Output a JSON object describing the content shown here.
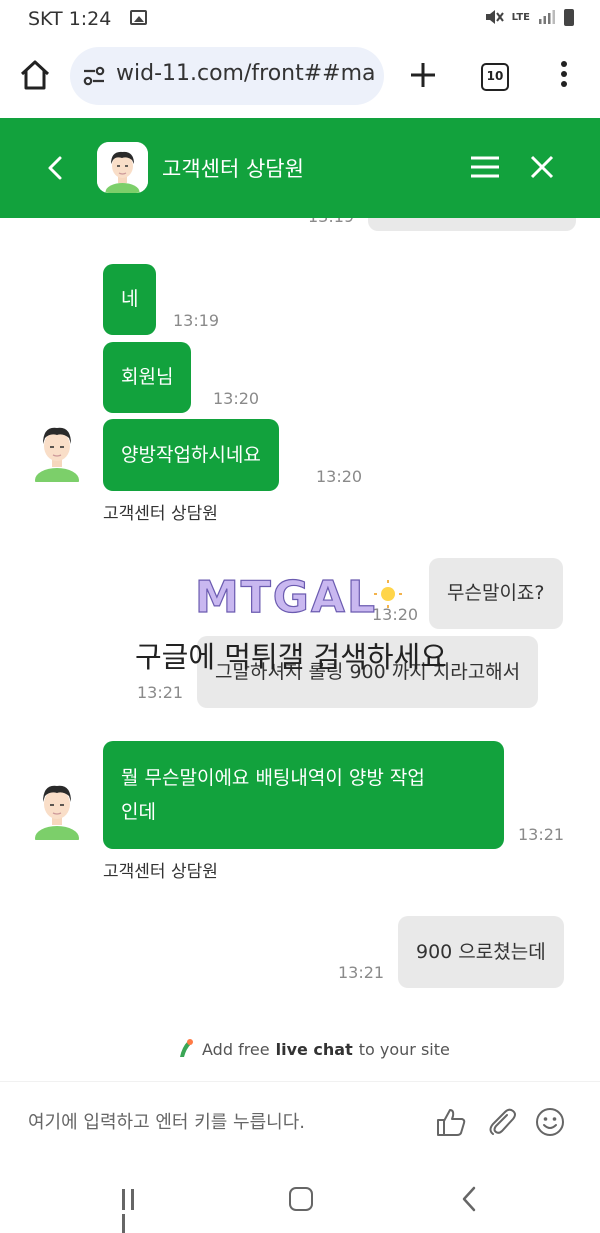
{
  "status_bar": {
    "carrier_time": "SKT 1:24",
    "network": "LTE"
  },
  "browser": {
    "url": "wid-11.com/front##ma",
    "tab_count": "10"
  },
  "header": {
    "title": "고객센터 상담원"
  },
  "messages": {
    "partial_time_top": "13:19",
    "m1": {
      "text": "네",
      "time": "13:19"
    },
    "m2": {
      "text": "회원님",
      "time": "13:20"
    },
    "m3": {
      "text": "양방작업하시네요",
      "time": "13:20"
    },
    "sender1": "고객센터 상담원",
    "u1": {
      "text": "무슨말이죠?",
      "time": "13:20"
    },
    "u2": {
      "text": "그말하셔지 롤링 900 까지 치라고해서",
      "time": "13:21"
    },
    "m4": {
      "line1": "뭘 무슨말이에요 배팅내역이 양방 작업",
      "line2": "인데",
      "time": "13:21"
    },
    "sender2": "고객센터 상담원",
    "u3": {
      "text": "900 으로쳤는데",
      "time": "13:21"
    }
  },
  "watermark": {
    "logo": "MTGAL",
    "text": "구글에 먹튀갤 검색하세요"
  },
  "powered": {
    "prefix": "Add free",
    "bold": "live chat",
    "suffix": "to your site"
  },
  "input": {
    "placeholder": "여기에 입력하고 엔터 키를 누릅니다."
  },
  "colors": {
    "brand_green": "#12a23d",
    "user_bubble": "#e9e9e9"
  }
}
